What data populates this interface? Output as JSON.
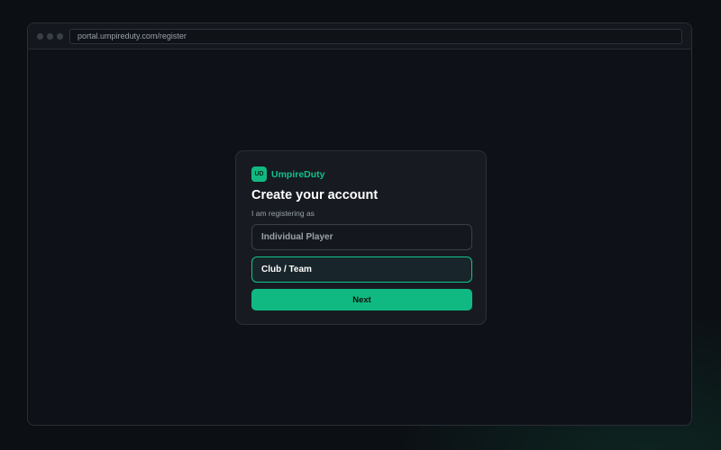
{
  "browser": {
    "url": "portal.umpireduty.com/register"
  },
  "brand": {
    "logo_text": "UD",
    "name": "UmpireDuty"
  },
  "form": {
    "title": "Create your account",
    "label": "I am registering as",
    "options": [
      {
        "label": "Individual Player",
        "selected": false
      },
      {
        "label": "Club / Team",
        "selected": true
      }
    ],
    "next_label": "Next"
  },
  "colors": {
    "accent": "#10b981",
    "background": "#0e1117",
    "card": "#171b21"
  }
}
